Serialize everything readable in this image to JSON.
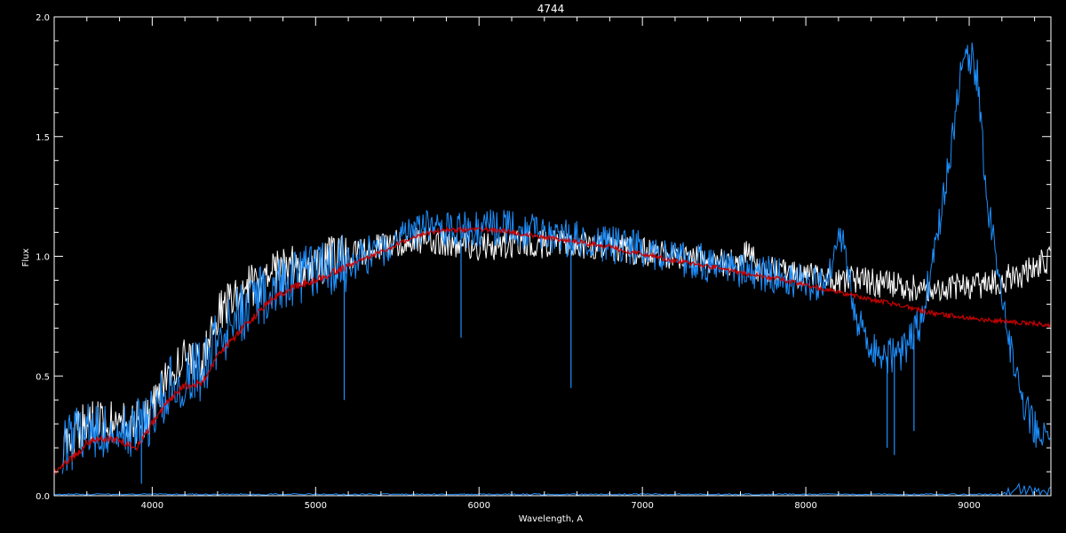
{
  "chart_data": {
    "type": "line",
    "title": "4744",
    "xlabel": "Wavelength, A",
    "ylabel": "Flux",
    "xlim": [
      3400,
      9500
    ],
    "ylim": [
      0,
      2.0
    ],
    "x_ticks": [
      4000,
      5000,
      6000,
      7000,
      8000,
      9000
    ],
    "x_tick_labels": [
      "4000",
      "5000",
      "6000",
      "7000",
      "8000",
      "9000"
    ],
    "y_ticks": [
      0,
      0.5,
      1.0,
      1.5,
      2.0
    ],
    "y_tick_labels": [
      "0.0",
      "0.5",
      "1.0",
      "1.5",
      "2.0"
    ],
    "grid": false,
    "background": "#000000",
    "axis_color": "#ffffff",
    "series": [
      {
        "color": "#ffffff",
        "x": [
          3450,
          3600,
          3800,
          3950,
          4000,
          4100,
          4200,
          4300,
          4400,
          4500,
          4600,
          4700,
          4800,
          4900,
          5000,
          5100,
          5200,
          5300,
          5400,
          5500,
          5600,
          5700,
          5800,
          5900,
          6000,
          6100,
          6200,
          6300,
          6400,
          6500,
          6600,
          6700,
          6800,
          6900,
          7000,
          7100,
          7200,
          7300,
          7400,
          7500,
          7600,
          7650,
          7700,
          7800,
          7900,
          8000,
          8100,
          8200,
          8300,
          8400,
          8500,
          8600,
          8700,
          8800,
          8900,
          9000,
          9100,
          9200,
          9300,
          9400,
          9500
        ],
        "y": [
          0.22,
          0.3,
          0.32,
          0.3,
          0.35,
          0.5,
          0.58,
          0.55,
          0.75,
          0.82,
          0.88,
          0.92,
          0.94,
          0.96,
          0.97,
          0.99,
          1.0,
          1.02,
          1.04,
          1.06,
          1.07,
          1.07,
          1.05,
          1.05,
          1.04,
          1.04,
          1.05,
          1.06,
          1.05,
          1.05,
          1.05,
          1.04,
          1.04,
          1.03,
          1.02,
          1.01,
          1.0,
          0.99,
          0.98,
          0.97,
          0.97,
          1.05,
          0.95,
          0.94,
          0.93,
          0.92,
          0.92,
          0.91,
          0.9,
          0.89,
          0.88,
          0.87,
          0.86,
          0.86,
          0.87,
          0.88,
          0.88,
          0.9,
          0.92,
          0.95,
          1.0
        ],
        "noise": 0.06
      },
      {
        "color": "#1e90ff",
        "x": [
          3450,
          3600,
          3800,
          3950,
          4000,
          4100,
          4200,
          4300,
          4400,
          4500,
          4600,
          4700,
          4800,
          4900,
          5000,
          5100,
          5200,
          5300,
          5400,
          5500,
          5600,
          5700,
          5800,
          5900,
          6000,
          6100,
          6200,
          6300,
          6400,
          6500,
          6600,
          6700,
          6800,
          6900,
          7000,
          7200,
          7400,
          7600,
          7800,
          8000,
          8100,
          8150,
          8200,
          8250,
          8300,
          8400,
          8500,
          8600,
          8700,
          8800,
          8900,
          8950,
          9000,
          9050,
          9100,
          9200,
          9300,
          9400,
          9500
        ],
        "y": [
          0.2,
          0.28,
          0.27,
          0.3,
          0.35,
          0.45,
          0.5,
          0.52,
          0.65,
          0.72,
          0.8,
          0.85,
          0.9,
          0.92,
          0.93,
          0.95,
          0.97,
          1.0,
          1.03,
          1.06,
          1.1,
          1.12,
          1.12,
          1.11,
          1.12,
          1.12,
          1.11,
          1.1,
          1.09,
          1.08,
          1.07,
          1.06,
          1.05,
          1.04,
          1.03,
          1.0,
          0.97,
          0.94,
          0.92,
          0.89,
          0.87,
          0.92,
          1.15,
          0.95,
          0.75,
          0.62,
          0.58,
          0.6,
          0.72,
          1.05,
          1.5,
          1.75,
          1.85,
          1.75,
          1.3,
          0.8,
          0.45,
          0.28,
          0.2
        ],
        "noise": 0.08
      },
      {
        "color": "#cc0000",
        "x": [
          3400,
          3500,
          3600,
          3700,
          3800,
          3900,
          4000,
          4100,
          4200,
          4300,
          4400,
          4500,
          4600,
          4700,
          4800,
          4900,
          5000,
          5100,
          5200,
          5300,
          5400,
          5500,
          5600,
          5700,
          5800,
          5900,
          6000,
          6100,
          6200,
          6300,
          6400,
          6500,
          6600,
          6700,
          6800,
          6900,
          7000,
          7200,
          7400,
          7600,
          7800,
          8000,
          8200,
          8400,
          8600,
          8800,
          9000,
          9200,
          9400,
          9500
        ],
        "y": [
          0.1,
          0.15,
          0.22,
          0.24,
          0.23,
          0.2,
          0.3,
          0.4,
          0.46,
          0.47,
          0.58,
          0.66,
          0.73,
          0.8,
          0.85,
          0.88,
          0.9,
          0.93,
          0.96,
          0.99,
          1.02,
          1.05,
          1.08,
          1.1,
          1.11,
          1.11,
          1.11,
          1.11,
          1.1,
          1.09,
          1.08,
          1.07,
          1.06,
          1.05,
          1.04,
          1.02,
          1.01,
          0.98,
          0.96,
          0.93,
          0.91,
          0.88,
          0.85,
          0.82,
          0.79,
          0.76,
          0.74,
          0.73,
          0.72,
          0.71
        ],
        "noise": 0.01
      }
    ],
    "absorption_lines": [
      {
        "x": 3934,
        "y_min": 0.05
      },
      {
        "x": 5175,
        "y_min": 0.4
      },
      {
        "x": 5890,
        "y_min": 0.66
      },
      {
        "x": 6563,
        "y_min": 0.45
      },
      {
        "x": 8498,
        "y_min": 0.2
      },
      {
        "x": 8542,
        "y_min": 0.17
      },
      {
        "x": 8662,
        "y_min": 0.27
      }
    ]
  }
}
